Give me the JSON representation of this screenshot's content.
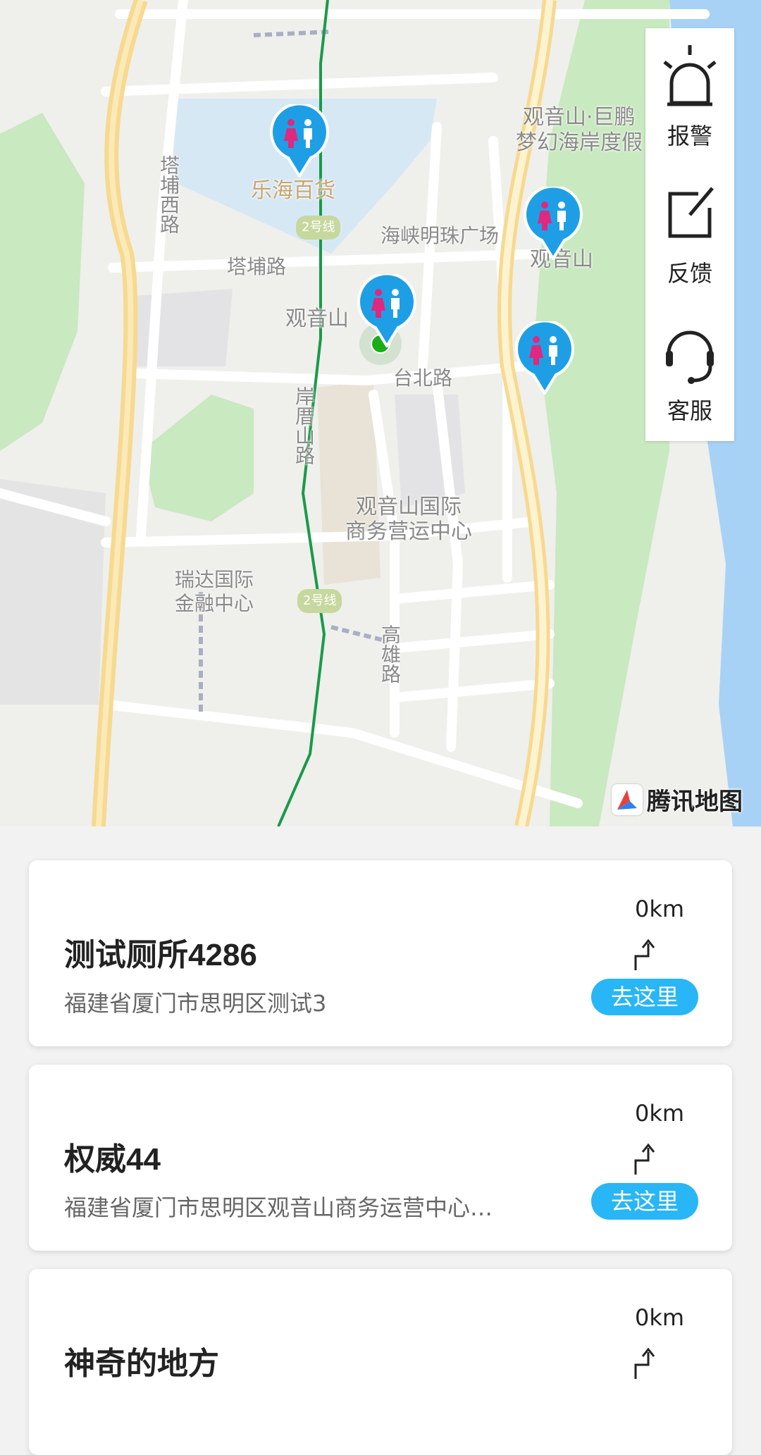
{
  "map": {
    "labels": {
      "lehai": "乐海百货",
      "haixia": "海峡明珠广场",
      "guanyinshan_metro": "观音山",
      "guanyinshan_east": "观音山",
      "tapu_road": "塔埔路",
      "tapu_west": "塔埔西路",
      "taibei_road": "台北路",
      "pinghu": "岸厝山路",
      "guanyinshan_center_1": "观音山国际",
      "guanyinshan_center_2": "商务营运中心",
      "ruida_1": "瑞达国际",
      "ruida_2": "金融中心",
      "gaoxiong_road": "高雄路",
      "beach_1": "观音山·巨鹏",
      "beach_2": "梦幻海岸度假",
      "metro_badge_1": "2号线",
      "metro_badge_2": "2号线"
    },
    "provider_logo": "腾讯地图",
    "pin_icon": "restroom-pin-icon",
    "accent_pin_color": "#1e9fe5"
  },
  "side_panel": {
    "alarm": {
      "label": "报警",
      "icon": "alarm-icon"
    },
    "feedback": {
      "label": "反馈",
      "icon": "feedback-icon"
    },
    "service": {
      "label": "客服",
      "icon": "headset-icon"
    }
  },
  "toilets": [
    {
      "name": "测试厕所4286",
      "address": "福建省厦门市思明区测试3",
      "distance": "0km",
      "action": "去这里"
    },
    {
      "name": "权威44",
      "address": "福建省厦门市思明区观音山商务运营中心…",
      "distance": "0km",
      "action": "去这里"
    },
    {
      "name": "神奇的地方",
      "distance": "0km"
    }
  ],
  "colors": {
    "go_button": "#28b6f6",
    "route_line": "#1a9a4a",
    "sea": "#a8d2f5",
    "park": "#c9e9c0",
    "highway": "#f7d98f"
  }
}
